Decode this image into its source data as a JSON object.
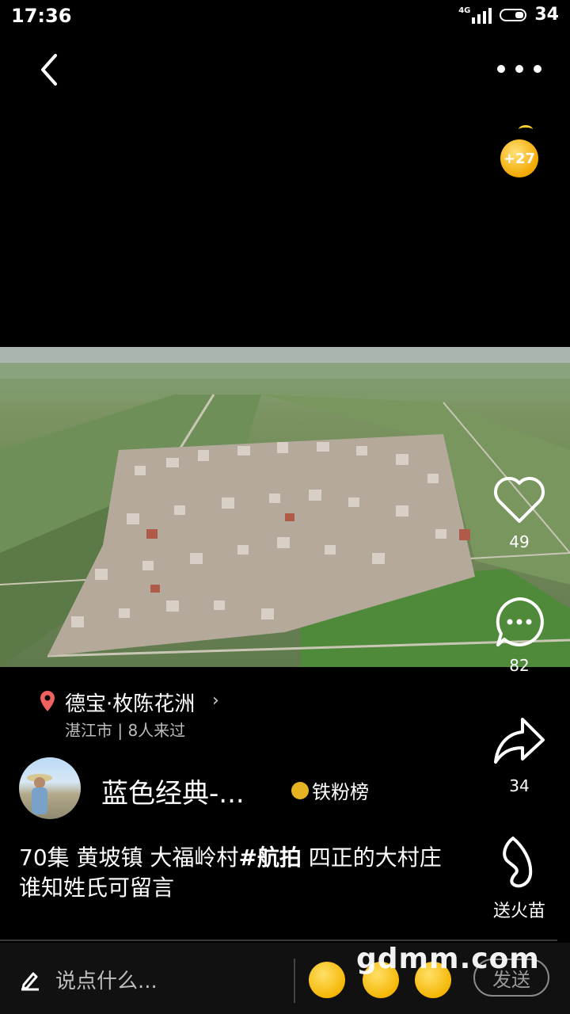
{
  "status_bar": {
    "time": "17:36",
    "network": "4G",
    "battery": "34"
  },
  "coin_badge": "+27",
  "location": {
    "name": "德宝·枚陈花洲",
    "sub": "湛江市 | 8人来过"
  },
  "author": {
    "name": "蓝色经典-...",
    "fan_badge": "铁粉榜"
  },
  "caption": {
    "part1": "70集 黄坡镇  大福岭村",
    "hashtag": "#航拍",
    "part2": "  四正的大村庄 谁知姓氏可留言"
  },
  "actions": {
    "likes": "49",
    "comments": "82",
    "shares": "34",
    "gift_label": "送火苗"
  },
  "bottom": {
    "placeholder": "说点什么...",
    "send": "发送"
  },
  "watermark": "gdmm.com",
  "icons": [
    "back-icon",
    "more-icon",
    "location-pin-icon",
    "chevron-right-icon",
    "heart-icon",
    "comment-icon",
    "share-icon",
    "flame-icon",
    "edit-icon",
    "emoji-smile-icon",
    "emoji-kiss-icon",
    "emoji-sweat-icon"
  ]
}
